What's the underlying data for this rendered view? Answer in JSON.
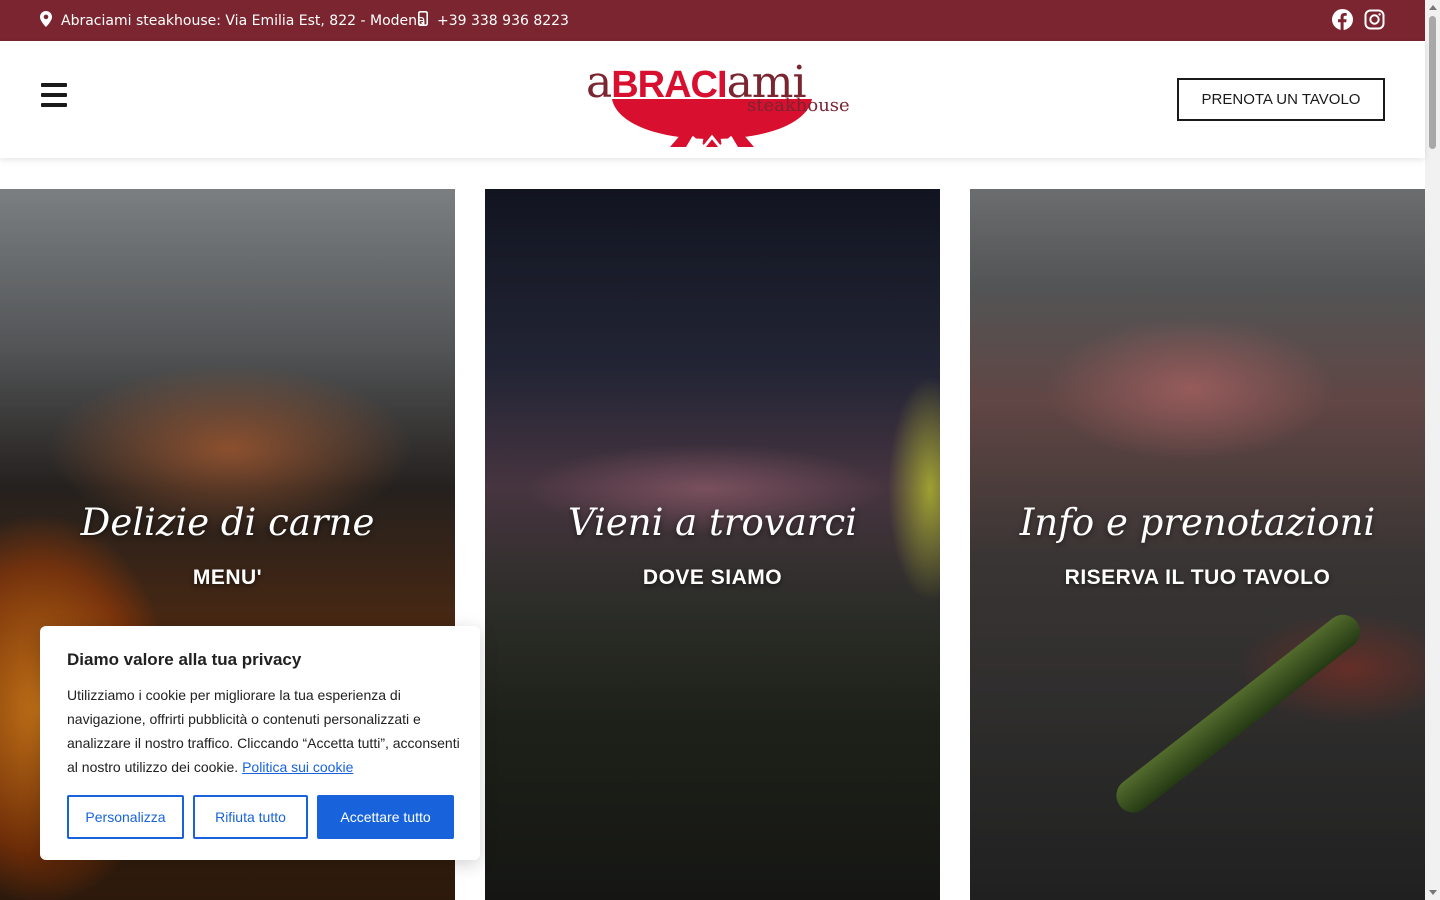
{
  "topbar": {
    "address": "Abraciami steakhouse: Via Emilia Est, 822 - Modena",
    "phone": "+39 338 936 8223",
    "icons": [
      "map-pin-icon",
      "phone-icon",
      "facebook-icon",
      "instagram-icon"
    ],
    "background_color": "#7a2530"
  },
  "header": {
    "logo": {
      "part_a": "a",
      "part_braci": "BRACI",
      "part_ami": "ami",
      "subtitle": "steakhouse"
    },
    "menu_icon": "hamburger-icon",
    "book_button": "PRENOTA UN TAVOLO"
  },
  "cards": [
    {
      "title": "Delizie di carne",
      "subtitle": "MENU'"
    },
    {
      "title": "Vieni a trovarci",
      "subtitle": "DOVE SIAMO"
    },
    {
      "title": "Info e prenotazioni",
      "subtitle": "RISERVA IL TUO TAVOLO"
    }
  ],
  "cookie_banner": {
    "title": "Diamo valore alla tua privacy",
    "text": "Utilizziamo i cookie per migliorare la tua esperienza di navigazione, offrirti pubblicità o contenuti personalizzati e analizzare il nostro traffico. Cliccando “Accetta tutti”, acconsenti al nostro utilizzo dei cookie.",
    "policy_link": "Politica sui cookie",
    "buttons": {
      "customize": "Personalizza",
      "reject": "Rifiuta tutto",
      "accept": "Accettare tutto"
    },
    "accent_color": "#1863dc"
  }
}
